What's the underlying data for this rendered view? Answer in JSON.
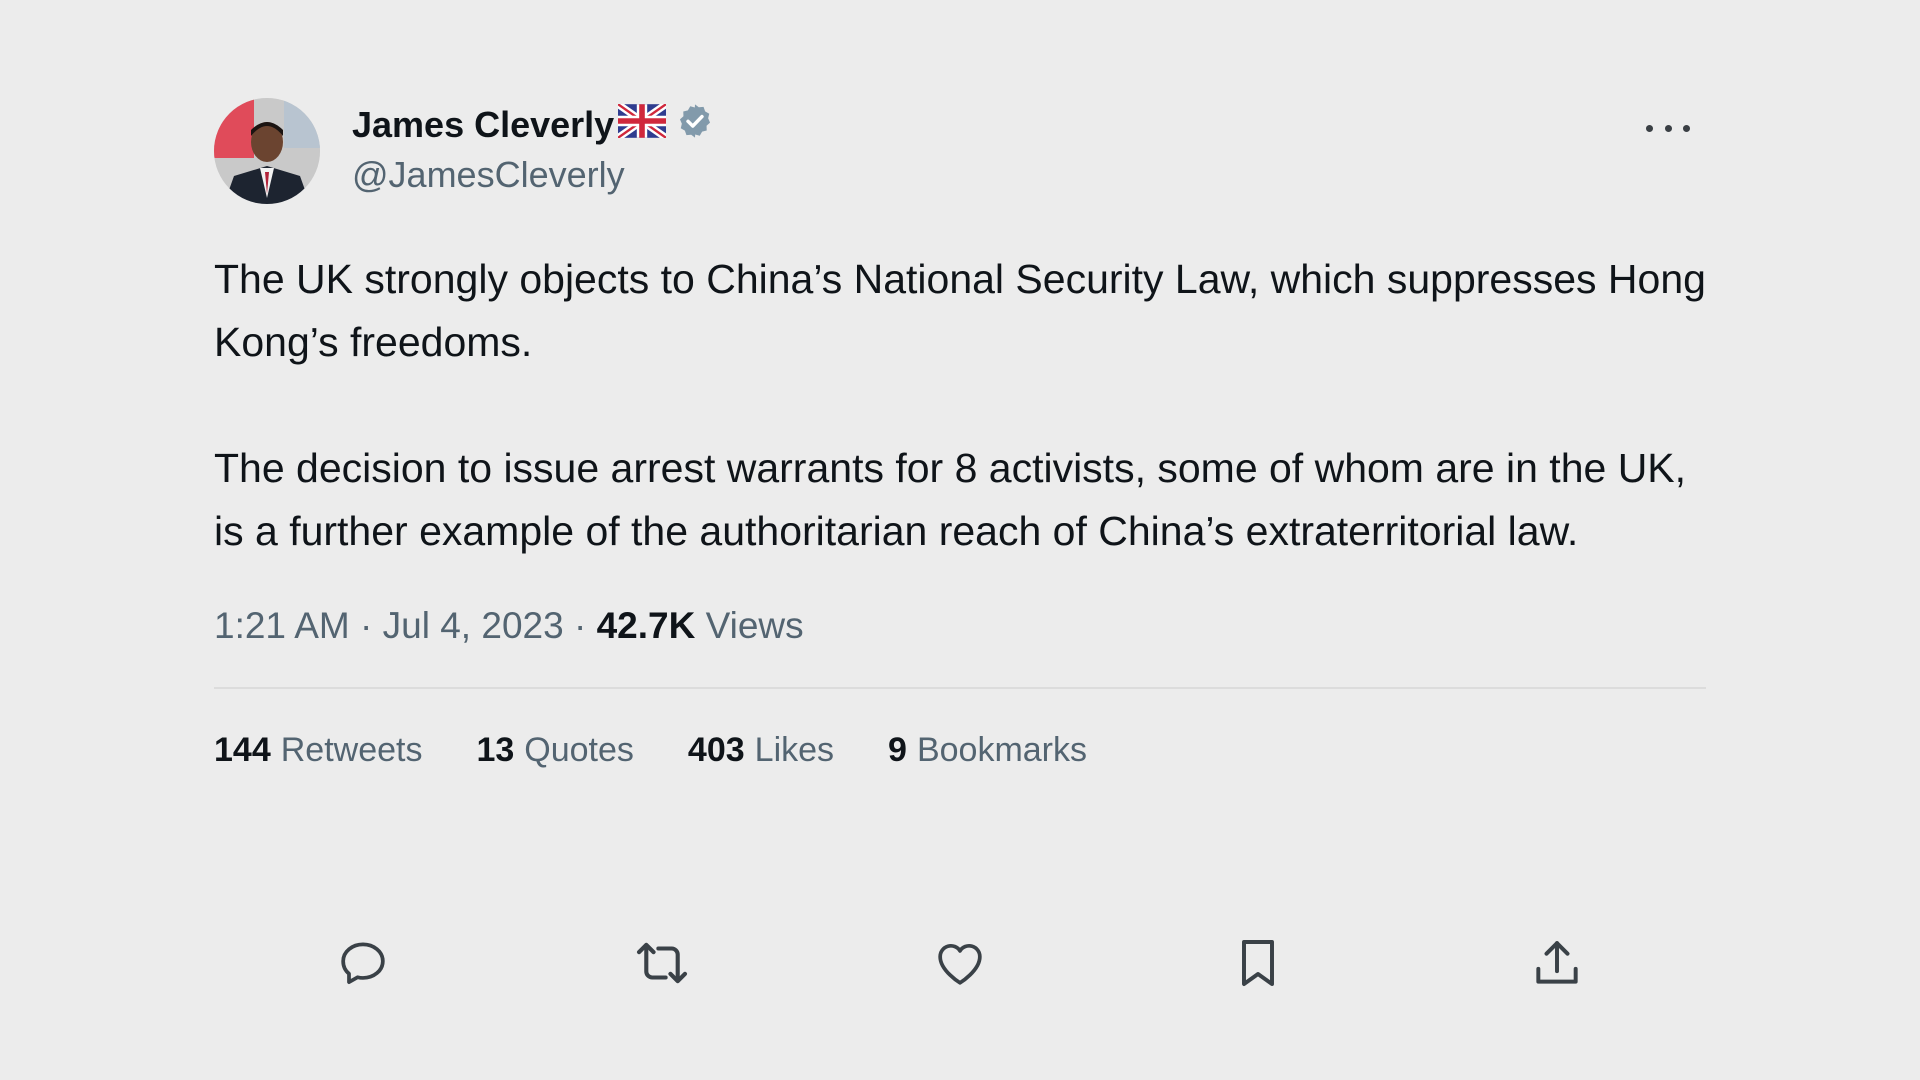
{
  "tweet": {
    "author": {
      "display_name": "James Cleverly",
      "flag_icon": "uk-flag-icon",
      "verified_icon": "verified-badge-icon",
      "handle": "@JamesCleverly"
    },
    "more_icon": "more-options-icon",
    "text": {
      "paragraph_1": "The UK strongly objects to China’s National Security Law, which suppresses Hong Kong’s freedoms.",
      "paragraph_2": "The decision to issue arrest warrants for 8 activists, some of whom are in the UK, is a further example of the authoritarian reach of China’s extraterritorial law."
    },
    "meta": {
      "time": "1:21 AM",
      "separator": "·",
      "date": "Jul 4, 2023",
      "views_count": "42.7K",
      "views_label": "Views"
    },
    "stats": [
      {
        "count": "144",
        "label": "Retweets"
      },
      {
        "count": "13",
        "label": "Quotes"
      },
      {
        "count": "403",
        "label": "Likes"
      },
      {
        "count": "9",
        "label": "Bookmarks"
      }
    ],
    "actions": [
      "reply-icon",
      "retweet-icon",
      "like-icon",
      "bookmark-icon",
      "share-icon"
    ]
  },
  "colors": {
    "background": "#ececec",
    "text_primary": "#0f1419",
    "text_secondary": "#536471",
    "verified": "#829aab",
    "divider": "#dcdcdc"
  }
}
